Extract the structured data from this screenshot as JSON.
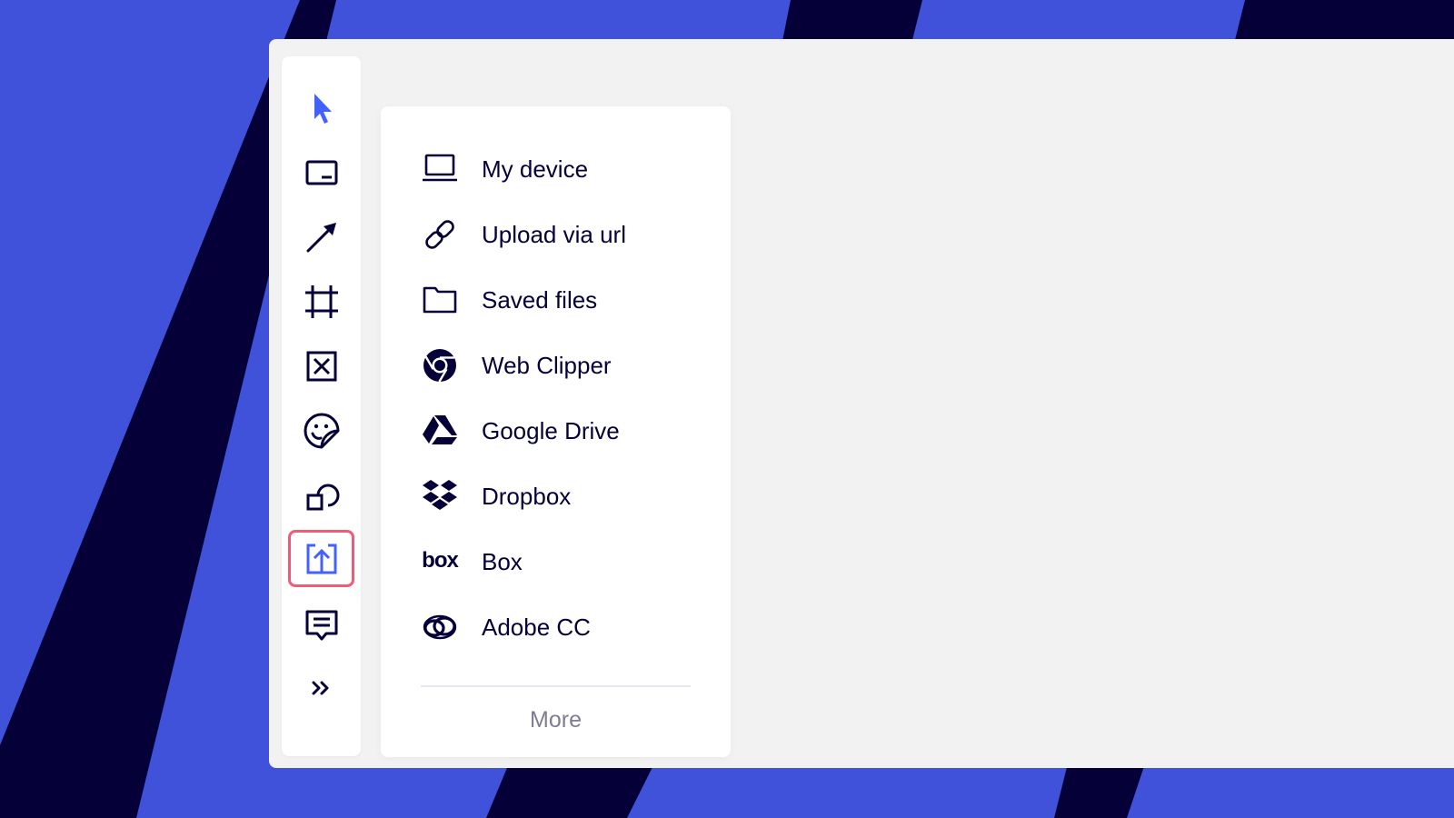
{
  "colors": {
    "background_blue": "#3f52d9",
    "background_navy": "#050038",
    "window_bg": "#f2f2f2",
    "panel_bg": "#ffffff",
    "icon_dark": "#050038",
    "accent_blue": "#4262ff",
    "active_outline": "#f25b73",
    "muted_text": "#7f7d96"
  },
  "toolbar": {
    "tools": [
      {
        "name": "select-tool",
        "icon": "cursor-icon",
        "active": false
      },
      {
        "name": "text-tool",
        "icon": "text-card-icon",
        "active": false
      },
      {
        "name": "line-tool",
        "icon": "arrow-icon",
        "active": false
      },
      {
        "name": "frame-tool",
        "icon": "frame-icon",
        "active": false
      },
      {
        "name": "crop-tool",
        "icon": "crossed-box-icon",
        "active": false
      },
      {
        "name": "sticker-tool",
        "icon": "sticker-icon",
        "active": false
      },
      {
        "name": "shapes-tool",
        "icon": "shapes-icon",
        "active": false
      },
      {
        "name": "upload-tool",
        "icon": "upload-icon",
        "active": true
      },
      {
        "name": "comment-tool",
        "icon": "comment-icon",
        "active": false
      },
      {
        "name": "more-tools",
        "icon": "double-chevron-right-icon",
        "active": false
      }
    ]
  },
  "upload_menu": {
    "items": [
      {
        "label": "My device",
        "icon": "laptop-icon"
      },
      {
        "label": "Upload via url",
        "icon": "link-icon"
      },
      {
        "label": "Saved files",
        "icon": "folder-icon"
      },
      {
        "label": "Web Clipper",
        "icon": "chrome-icon"
      },
      {
        "label": "Google Drive",
        "icon": "google-drive-icon"
      },
      {
        "label": "Dropbox",
        "icon": "dropbox-icon"
      },
      {
        "label": "Box",
        "icon": "box-logo-icon",
        "logo_text": "box"
      },
      {
        "label": "Adobe CC",
        "icon": "adobe-cc-icon"
      }
    ],
    "more_label": "More"
  }
}
